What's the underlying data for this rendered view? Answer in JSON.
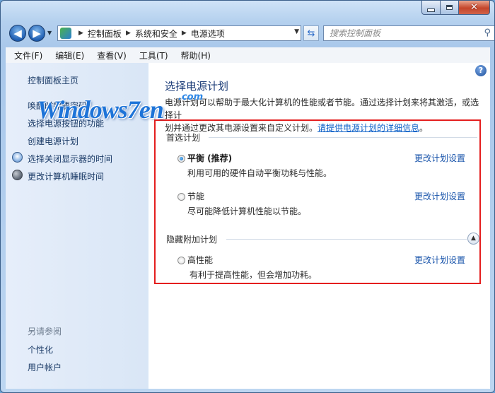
{
  "window": {
    "caption": {
      "min": "minimize",
      "max": "maximize",
      "close": "✕"
    }
  },
  "nav": {
    "breadcrumb": [
      "控制面板",
      "系统和安全",
      "电源选项"
    ],
    "search_placeholder": "搜索控制面板"
  },
  "menu": [
    "文件(F)",
    "编辑(E)",
    "查看(V)",
    "工具(T)",
    "帮助(H)"
  ],
  "sidebar": {
    "home": "控制面板主页",
    "wake": "唤醒时需要密码",
    "buttons": "选择电源按钮的功能",
    "create": "创建电源计划",
    "display_off": "选择关闭显示器的时间",
    "sleep": "更改计算机睡眠时间",
    "see_also": "另请参阅",
    "personalize": "个性化",
    "accounts": "用户帐户"
  },
  "main": {
    "help": "?",
    "title": "选择电源计划",
    "desc_line1": "电源计划可以帮助于最大化计算机的性能或者节能。通过选择计划来将其激活，或选择计",
    "desc_line2_prefix": "划并通过更改其电源设置来自定义计划。",
    "desc_link": "请提供电源计划的详细信息",
    "desc_line2_suffix": "。",
    "preferred_header": "首选计划",
    "hidden_header": "隐藏附加计划",
    "plans": [
      {
        "name": "平衡 (推荐)",
        "desc": "利用可用的硬件自动平衡功耗与性能。",
        "link": "更改计划设置",
        "selected": true
      },
      {
        "name": "节能",
        "desc": "尽可能降低计算机性能以节能。",
        "link": "更改计划设置",
        "selected": false
      },
      {
        "name": "高性能",
        "desc": "有利于提高性能，但会增加功耗。",
        "link": "更改计划设置",
        "selected": false
      }
    ]
  },
  "watermark": {
    "text": "Windows7en",
    "suffix": ".com"
  },
  "colors": {
    "highlight_box": "#e41e1e",
    "link": "#1a55ab",
    "title": "#1d3d78"
  }
}
